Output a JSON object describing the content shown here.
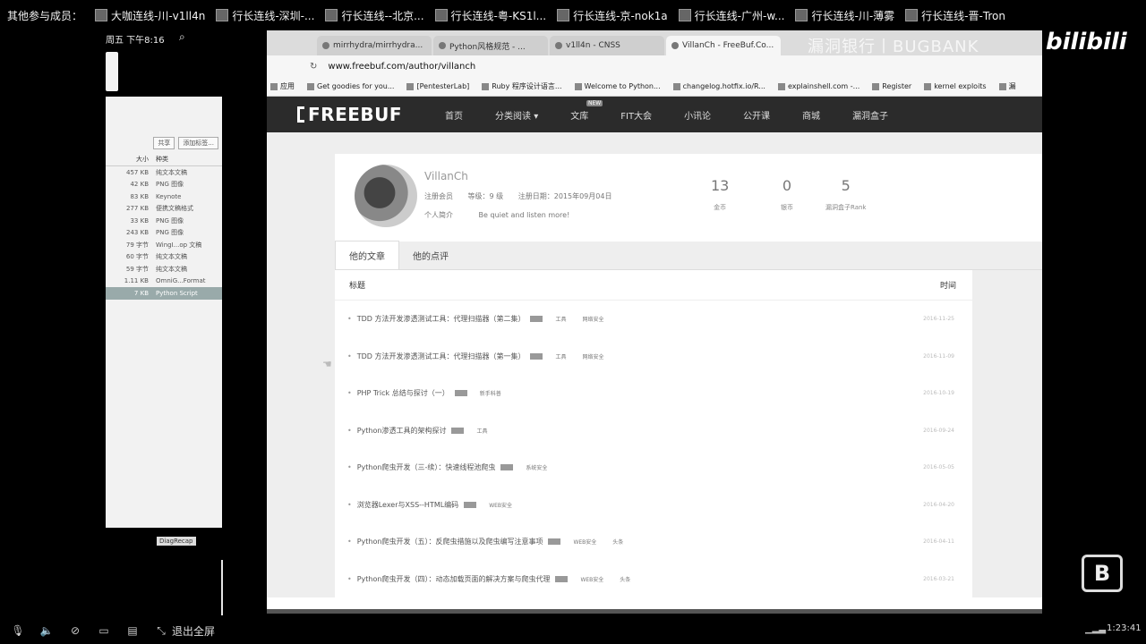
{
  "topbar": {
    "label": "其他参与成员：",
    "participants": [
      "大咖连线-川-v1ll4n",
      "行长连线-深圳-...",
      "行长连线--北京...",
      "行长连线-粤-KS1l...",
      "行长连线-京-nok1a",
      "行长连线-广州-w...",
      "行长连线-川-薄雾",
      "行长连线-晋-Tron"
    ]
  },
  "clock": "周五 下午8:16",
  "watermark": {
    "text": "漏洞银行丨BUGBANK",
    "brand": "bilibili"
  },
  "finder": {
    "buttons": [
      "共享",
      "添加标签..."
    ],
    "headers": {
      "size": "大小",
      "kind": "种类"
    },
    "rows": [
      {
        "size": "457 KB",
        "kind": "纯文本文稿"
      },
      {
        "size": "42 KB",
        "kind": "PNG 图像"
      },
      {
        "size": "83 KB",
        "kind": "Keynote"
      },
      {
        "size": "277 KB",
        "kind": "便携文稿格式"
      },
      {
        "size": "33 KB",
        "kind": "PNG 图像"
      },
      {
        "size": "243 KB",
        "kind": "PNG 图像"
      },
      {
        "size": "79 字节",
        "kind": "WingI...op 文稿"
      },
      {
        "size": "60 字节",
        "kind": "纯文本文稿"
      },
      {
        "size": "59 字节",
        "kind": "纯文本文稿"
      },
      {
        "size": "1.11 KB",
        "kind": "OmniG...Format"
      },
      {
        "size": "7 KB",
        "kind": "Python Script"
      }
    ],
    "chip": "DiagRecap"
  },
  "browser": {
    "tabs": [
      {
        "label": "mirrhydra/mirrhydra...",
        "active": false
      },
      {
        "label": "Python风格规范 - ...",
        "active": false
      },
      {
        "label": "v1ll4n - CNSS",
        "active": false
      },
      {
        "label": "VillanCh - FreeBuf.Co...",
        "active": true
      }
    ],
    "url": "www.freebuf.com/author/villanch",
    "bookmarks": [
      "应用",
      "Get goodies for you...",
      "[PentesterLab]",
      "Ruby 程序设计语言...",
      "Welcome to Python...",
      "changelog.hotfix.io/R...",
      "explainshell.com -...",
      "Register",
      "kernel exploits",
      "漏"
    ]
  },
  "site": {
    "logo": "FREEBUF",
    "nav": [
      "首页",
      "分类阅读 ▾",
      "文库",
      "FIT大会",
      "小讯论",
      "公开课",
      "商城",
      "漏洞盒子"
    ],
    "nav_badge": "NEW"
  },
  "profile": {
    "name": "VillanCh",
    "level_label": "注册会员",
    "grade": "等级：9 级",
    "register_date": "注册日期：2015年09月04日",
    "intro_label": "个人简介",
    "intro": "Be quiet and listen more!",
    "stats": [
      {
        "value": "13",
        "label": "金币"
      },
      {
        "value": "0",
        "label": "银币"
      },
      {
        "value": "5",
        "label": "漏洞盒子Rank"
      }
    ]
  },
  "article_tabs": [
    "他的文章",
    "他的点评"
  ],
  "article_list": {
    "headers": {
      "title": "标题",
      "time": "时间"
    },
    "items": [
      {
        "title": "TDD 方法开发渗透测试工具：代理扫描器（第二集）",
        "tags": [
          "工具",
          "网络安全"
        ],
        "date": "2016-11-25"
      },
      {
        "title": "TDD 方法开发渗透测试工具：代理扫描器（第一集）",
        "tags": [
          "工具",
          "网络安全"
        ],
        "date": "2016-11-09"
      },
      {
        "title": "PHP Trick 总结与探讨（一）",
        "tags": [
          "新手科普"
        ],
        "date": "2016-10-19"
      },
      {
        "title": "Python渗透工具的架构探讨",
        "tags": [
          "工具"
        ],
        "date": "2016-09-24"
      },
      {
        "title": "Python爬虫开发（三-续）：快速线程池爬虫",
        "tags": [
          "系统安全"
        ],
        "date": "2016-05-05"
      },
      {
        "title": "浏览器Lexer与XSS--HTML编码",
        "tags": [
          "WEB安全"
        ],
        "date": "2016-04-20"
      },
      {
        "title": "Python爬虫开发（五）：反爬虫措施以及爬虫编写注意事项",
        "tags": [
          "WEB安全",
          "头条"
        ],
        "date": "2016-04-11"
      },
      {
        "title": "Python爬虫开发（四）：动态加载页面的解决方案与爬虫代理",
        "tags": [
          "WEB安全",
          "头条"
        ],
        "date": "2016-03-21"
      }
    ]
  },
  "bottombar": {
    "fullscreen": "退出全屏",
    "elapsed": "1:23:41"
  }
}
